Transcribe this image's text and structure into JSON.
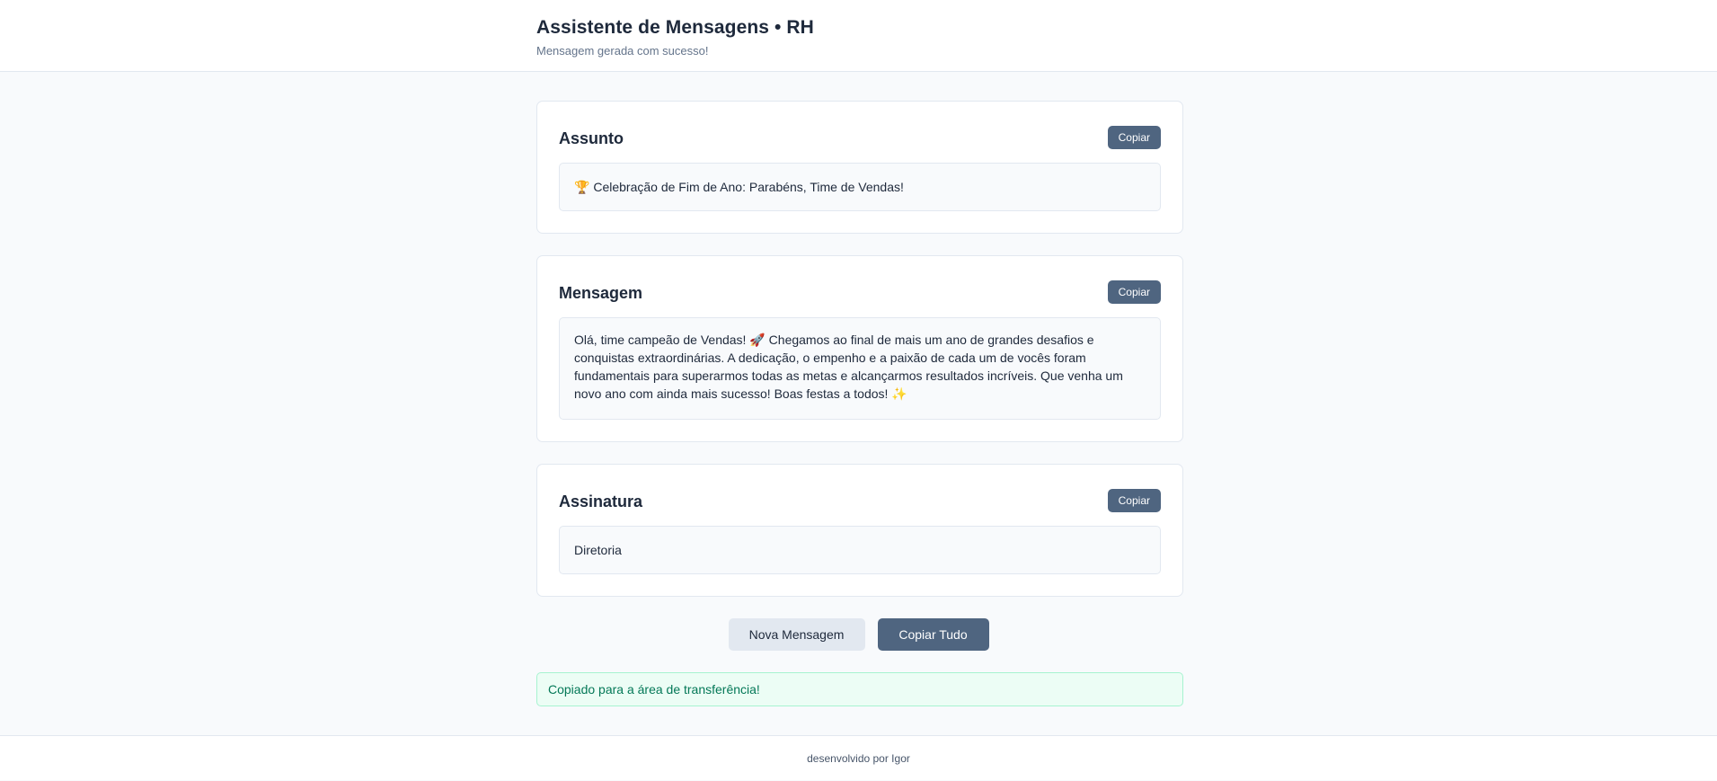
{
  "header": {
    "title": "Assistente de Mensagens • RH",
    "subtitle": "Mensagem gerada com sucesso!"
  },
  "subject": {
    "title": "Assunto",
    "copy_label": "Copiar",
    "emoji": "🏆",
    "text": "Celebração de Fim de Ano: Parabéns, Time de Vendas!"
  },
  "message": {
    "title": "Mensagem",
    "copy_label": "Copiar",
    "text_before": "Olá, time campeão de Vendas!",
    "emoji_1": "🚀",
    "text_after": "Chegamos ao final de mais um ano de grandes desafios e conquistas extraordinárias. A dedicação, o empenho e a paixão de cada um de vocês foram fundamentais para superarmos todas as metas e alcançarmos resultados incríveis. Que venha um novo ano com ainda mais sucesso! Boas festas a todos!",
    "emoji_2": "✨"
  },
  "signature": {
    "title": "Assinatura",
    "copy_label": "Copiar",
    "text": "Diretoria"
  },
  "actions": {
    "new_label": "Nova Mensagem",
    "copy_all_label": "Copiar Tudo"
  },
  "toast": {
    "text": "Copiado para a área de transferência!"
  },
  "footer": {
    "text": "desenvolvido por Igor"
  }
}
